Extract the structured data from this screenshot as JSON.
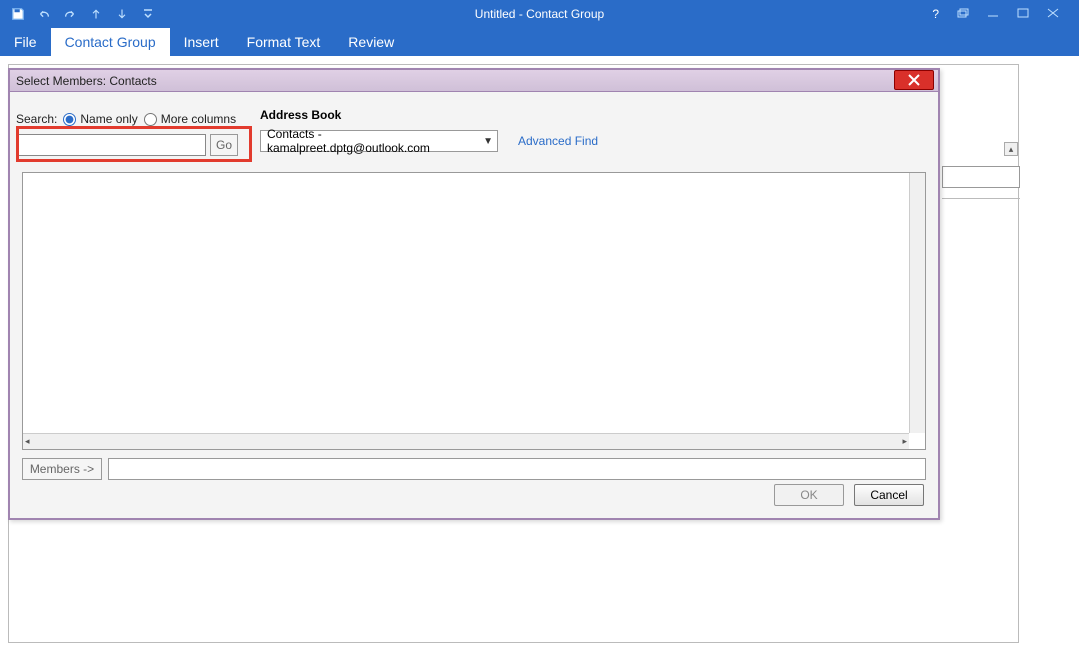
{
  "titlebar": {
    "title": "Untitled - Contact Group"
  },
  "ribbon": {
    "tabs": {
      "file": "File",
      "contact_group": "Contact Group",
      "insert": "Insert",
      "format_text": "Format Text",
      "review": "Review"
    }
  },
  "dialog": {
    "title": "Select Members: Contacts",
    "search_label": "Search:",
    "radio_name_only": "Name only",
    "radio_more_cols": "More columns",
    "address_book_label": "Address Book",
    "go_label": "Go",
    "address_book_value": "Contacts - kamalpreet.dptg@outlook.com",
    "advanced_find": "Advanced Find",
    "members_button": "Members ->",
    "ok": "OK",
    "cancel": "Cancel",
    "search_value": ""
  }
}
